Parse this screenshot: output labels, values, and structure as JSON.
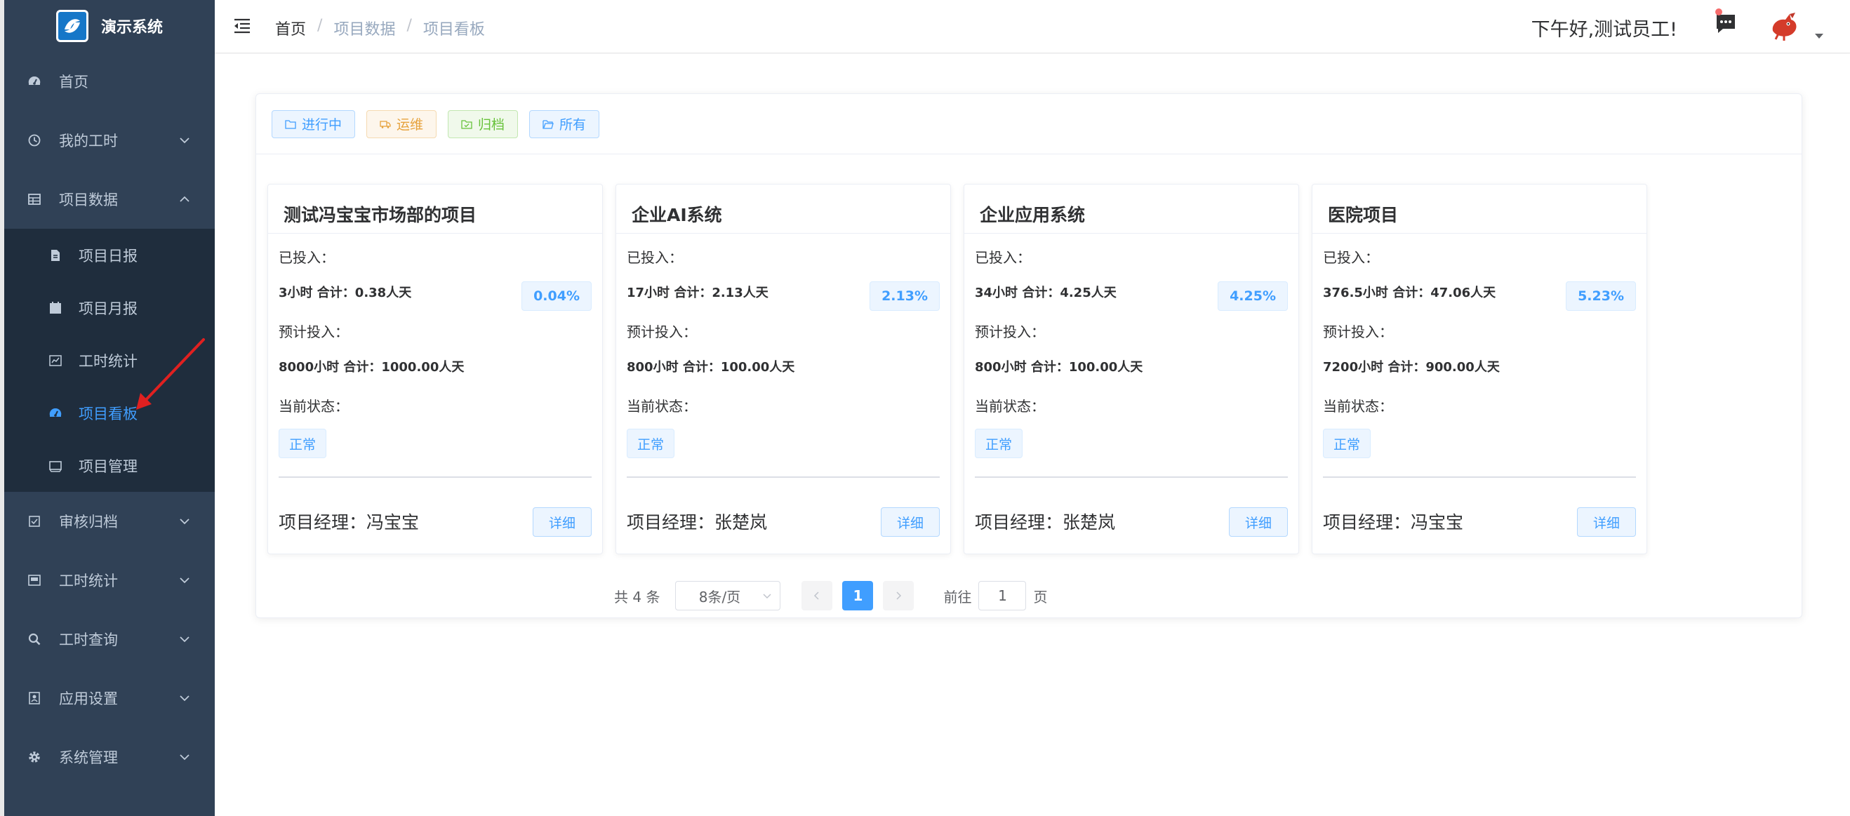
{
  "app": {
    "title": "演示系统"
  },
  "sidebar": {
    "items": [
      {
        "label": "首页",
        "icon": "dashboard-icon"
      },
      {
        "label": "我的工时",
        "icon": "clock-icon"
      },
      {
        "label": "项目数据",
        "icon": "table-icon",
        "expanded": true,
        "children": [
          {
            "label": "项目日报",
            "icon": "document-icon"
          },
          {
            "label": "项目月报",
            "icon": "calendar-icon"
          },
          {
            "label": "工时统计",
            "icon": "chart-icon"
          },
          {
            "label": "项目看板",
            "icon": "dashboard-icon",
            "active": true
          },
          {
            "label": "项目管理",
            "icon": "monitor-icon"
          }
        ]
      },
      {
        "label": "审核归档",
        "icon": "checkbox-icon"
      },
      {
        "label": "工时统计",
        "icon": "picture-icon"
      },
      {
        "label": "工时查询",
        "icon": "search-icon"
      },
      {
        "label": "应用设置",
        "icon": "user-card-icon"
      },
      {
        "label": "系统管理",
        "icon": "gear-icon"
      }
    ]
  },
  "header": {
    "breadcrumb": [
      "首页",
      "项目数据",
      "项目看板"
    ],
    "greeting": "下午好,测试员工!"
  },
  "filters": [
    "进行中",
    "运维",
    "归档",
    "所有"
  ],
  "labels": {
    "invested": "已投入：",
    "planned": "预计投入：",
    "status": "当前状态：",
    "manager_prefix": "项目经理：",
    "detail": "详细"
  },
  "projects": [
    {
      "name": "测试冯宝宝市场部的项目",
      "invested": "3小时 合计：0.38人天",
      "percent": "0.04%",
      "planned": "8000小时 合计：1000.00人天",
      "status": "正常",
      "manager": "项目经理：冯宝宝"
    },
    {
      "name": "企业AI系统",
      "invested": "17小时 合计：2.13人天",
      "percent": "2.13%",
      "planned": "800小时 合计：100.00人天",
      "status": "正常",
      "manager": "项目经理：张楚岚"
    },
    {
      "name": "企业应用系统",
      "invested": "34小时 合计：4.25人天",
      "percent": "4.25%",
      "planned": "800小时 合计：100.00人天",
      "status": "正常",
      "manager": "项目经理：张楚岚"
    },
    {
      "name": "医院项目",
      "invested": "376.5小时 合计：47.06人天",
      "percent": "5.23%",
      "planned": "7200小时 合计：900.00人天",
      "status": "正常",
      "manager": "项目经理：冯宝宝"
    }
  ],
  "pagination": {
    "total": "共 4 条",
    "page_size": "8条/页",
    "current": "1",
    "goto_prefix": "前往",
    "goto_value": "1",
    "goto_suffix": "页"
  },
  "colors": {
    "sidebar_bg": "#304156",
    "submenu_bg": "#1f2d3d",
    "accent": "#409eff",
    "annotation_arrow": "#e02020"
  }
}
